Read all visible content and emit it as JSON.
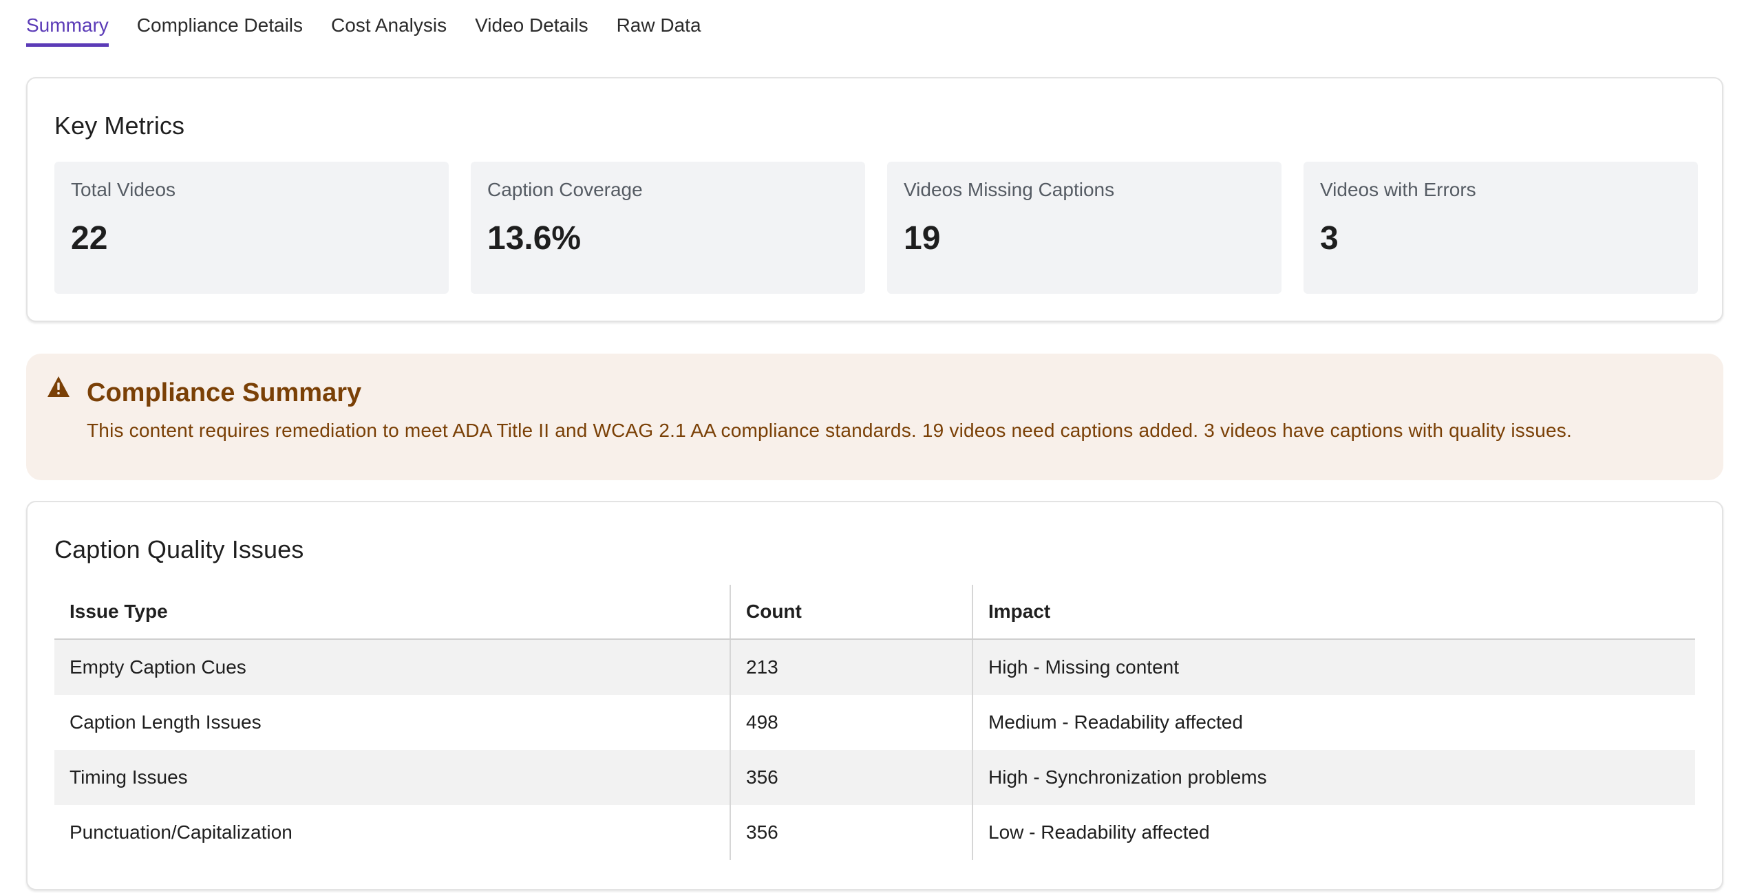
{
  "tabs": [
    {
      "label": "Summary",
      "active": true
    },
    {
      "label": "Compliance Details",
      "active": false
    },
    {
      "label": "Cost Analysis",
      "active": false
    },
    {
      "label": "Video Details",
      "active": false
    },
    {
      "label": "Raw Data",
      "active": false
    }
  ],
  "metrics": {
    "title": "Key Metrics",
    "items": [
      {
        "label": "Total Videos",
        "value": "22"
      },
      {
        "label": "Caption Coverage",
        "value": "13.6%"
      },
      {
        "label": "Videos Missing Captions",
        "value": "19"
      },
      {
        "label": "Videos with Errors",
        "value": "3"
      }
    ]
  },
  "compliance": {
    "icon": "warning-icon",
    "title": "Compliance Summary",
    "text": "This content requires remediation to meet ADA Title II and WCAG 2.1 AA compliance standards. 19 videos need captions added. 3 videos have captions with quality issues.",
    "color": "#7a4006",
    "background": "#f8f0ea"
  },
  "issues": {
    "title": "Caption Quality Issues",
    "headers": [
      "Issue Type",
      "Count",
      "Impact"
    ],
    "rows": [
      [
        "Empty Caption Cues",
        "213",
        "High - Missing content"
      ],
      [
        "Caption Length Issues",
        "498",
        "Medium - Readability affected"
      ],
      [
        "Timing Issues",
        "356",
        "High - Synchronization problems"
      ],
      [
        "Punctuation/Capitalization",
        "356",
        "Low - Readability affected"
      ]
    ]
  },
  "colors": {
    "accent": "#5b3bb7"
  }
}
